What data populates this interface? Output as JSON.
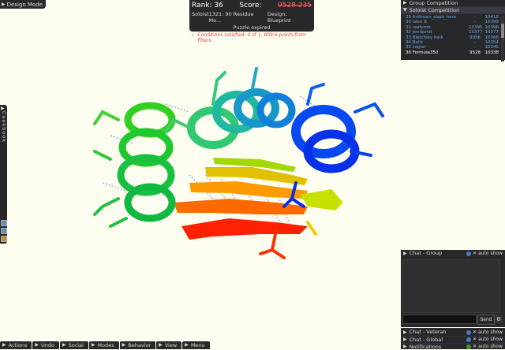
{
  "design_mode": {
    "label": "Design Mode"
  },
  "hud": {
    "rank_label": "Rank: 36",
    "score_label": "Score:",
    "score_value": "9528.235",
    "role": "Soloist",
    "puzzle": "1321: 90 Residue Mo...",
    "design": "Design: Blueprint",
    "status": "Puzzle expired",
    "conditions": "Conditions satisfied: 0 of 1, 809.6 points from filters"
  },
  "competition": {
    "group_label": "Group Competition",
    "soloist_label": "Soloist Competition",
    "rows": [
      {
        "name": "29 Anfinsen_slept_here",
        "delta": "-",
        "score": "10418"
      },
      {
        "name": "30 Glen B",
        "delta": "-",
        "score": "10399"
      },
      {
        "name": "31 reefyrob",
        "delta": "10395",
        "score": "10398"
      },
      {
        "name": "32 pmdpmd",
        "delta": "10377",
        "score": "10377"
      },
      {
        "name": "33 Bletchley Park",
        "delta": "9056",
        "score": "10366"
      },
      {
        "name": "34 Bailz",
        "delta": "-",
        "score": "10354"
      },
      {
        "name": "35 caglar",
        "delta": "-",
        "score": "10345"
      },
      {
        "name": "36 Formula350",
        "delta": "9528",
        "score": "10338"
      }
    ]
  },
  "cookbook": {
    "label": "Cookbook"
  },
  "chat": {
    "group_label": "Chat - Group",
    "auto_show": "auto show",
    "send_label": "Send",
    "veteran_label": "Chat - Veteran",
    "global_label": "Chat - Global",
    "notifications_label": "Notifications"
  },
  "bottom_bar": [
    {
      "label": "Actions"
    },
    {
      "label": "Undo"
    },
    {
      "label": "Social"
    },
    {
      "label": "Modes"
    },
    {
      "label": "Behavior"
    },
    {
      "label": "View"
    },
    {
      "label": "Menu"
    }
  ]
}
